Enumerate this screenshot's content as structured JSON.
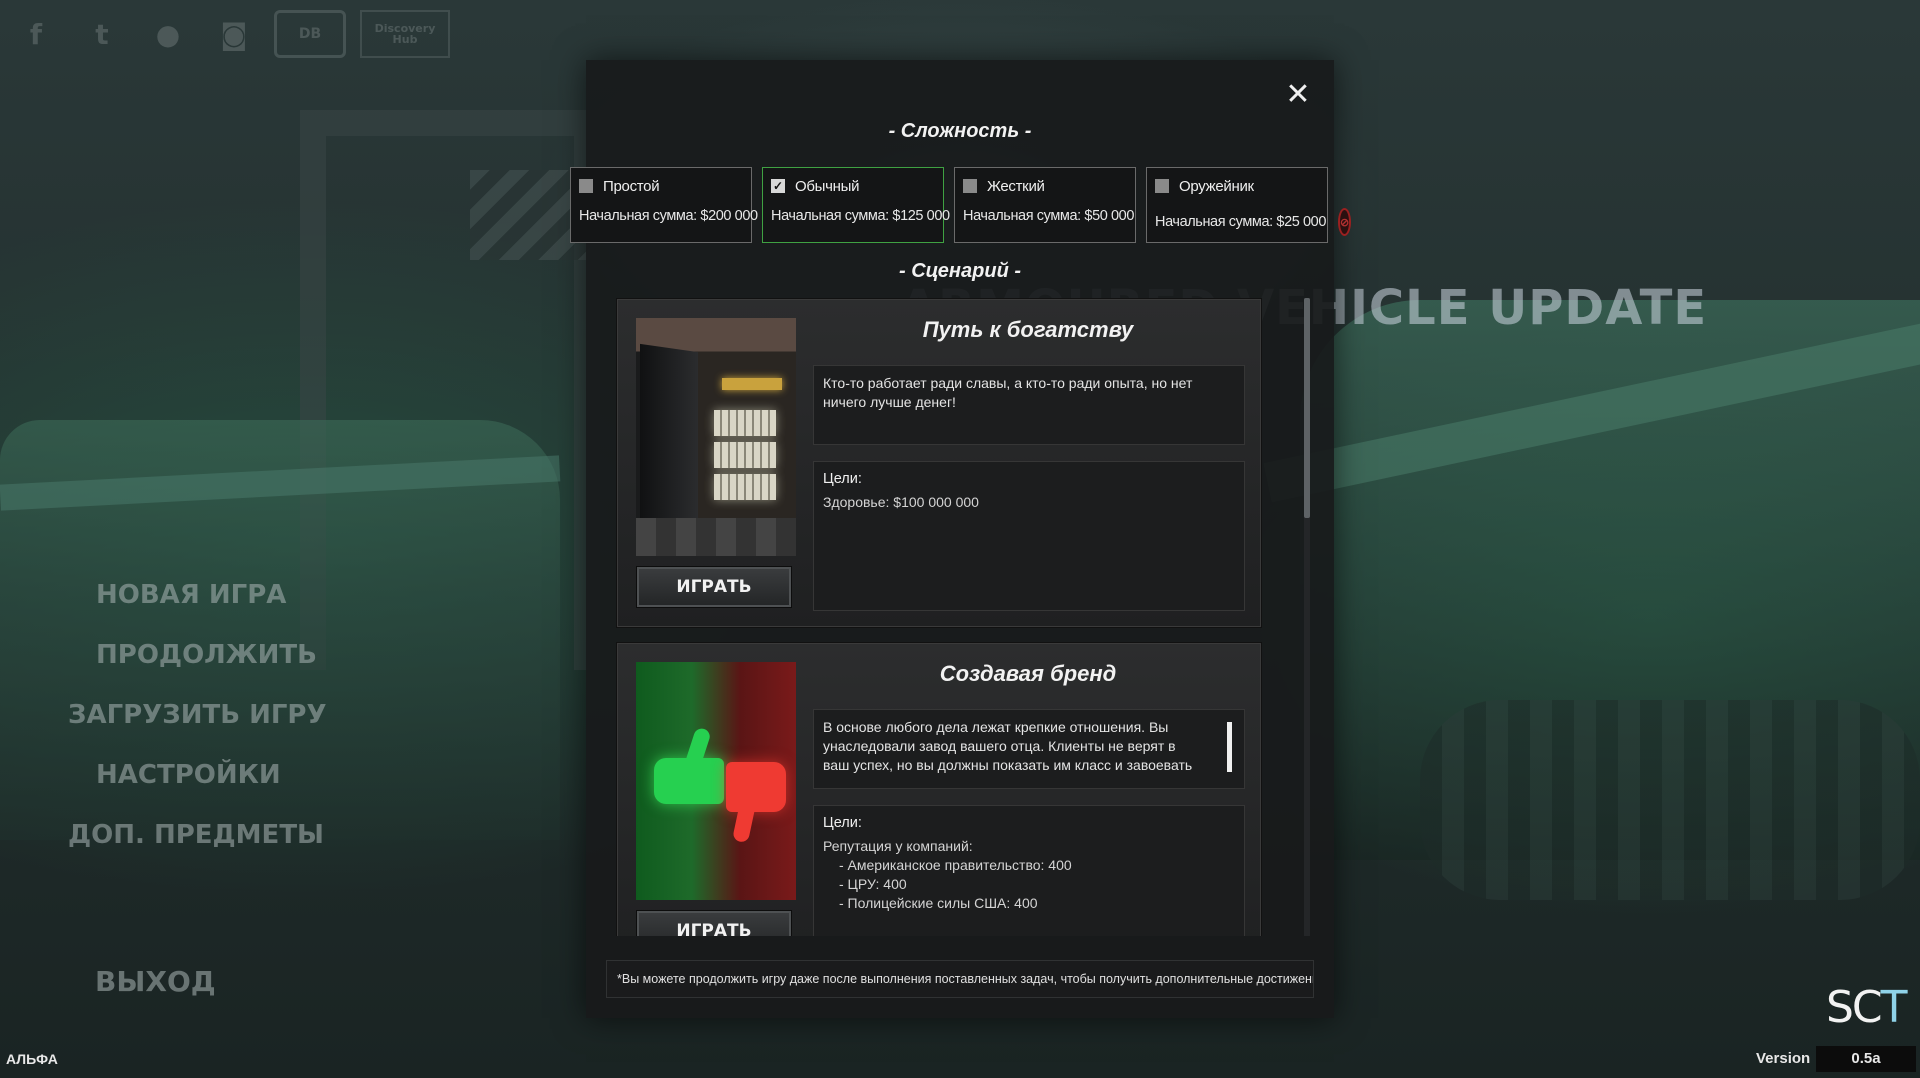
{
  "social": {
    "icons": [
      {
        "name": "facebook-icon",
        "glyph": "f"
      },
      {
        "name": "twitter-icon",
        "glyph": "t"
      },
      {
        "name": "reddit-icon",
        "glyph": "●"
      },
      {
        "name": "discord-icon",
        "glyph": "◙"
      },
      {
        "name": "indiedb-icon",
        "glyph": "DB"
      },
      {
        "name": "discovery-hub-icon",
        "glyph": "Discovery Hub"
      }
    ]
  },
  "background": {
    "update_title": "ARMOURED VEHICLE UPDATE"
  },
  "main_menu": {
    "items": [
      "НОВАЯ ИГРА",
      "ПРОДОЛЖИТЬ",
      "ЗАГРУЗИТЬ ИГРУ",
      "НАСТРОЙКИ",
      "ДОП. ПРЕДМЕТЫ"
    ],
    "exit": "ВЫХОД"
  },
  "footer": {
    "alpha": "АЛЬФА",
    "version_label": "Version",
    "version_value": "0.5a",
    "logo_text_a": "SC",
    "logo_text_b": "T"
  },
  "modal": {
    "close_glyph": "✕",
    "difficulty_title": "- Сложность -",
    "scenario_title": "- Сценарий -",
    "difficulties": [
      {
        "name": "Простой",
        "amount": "Начальная сумма: $200 000",
        "checked": false
      },
      {
        "name": "Обычный",
        "amount": "Начальная сумма: $125 000",
        "checked": true
      },
      {
        "name": "Жесткий",
        "amount": "Начальная сумма: $50 000",
        "checked": false
      },
      {
        "name": "Оружейник",
        "amount": "Начальная сумма: $25 000",
        "checked": false,
        "no_achievements_icon": true
      }
    ],
    "scenarios": [
      {
        "title": "Путь к богатству",
        "description": "Кто-то работает ради славы, а кто-то ради опыта, но нет ничего лучше денег!",
        "goals_label": "Цели:",
        "goals": [
          "Здоровье:  $100 000 000"
        ],
        "goal_subitems": [],
        "play_label": "ИГРАТЬ"
      },
      {
        "title": "Создавая бренд",
        "description": "В основе любого дела лежат крепкие отношения. Вы унаследовали завод вашего отца. Клиенты не верят в ваш успех, но вы должны показать им класс и завоевать",
        "goals_label": "Цели:",
        "goals": [
          "Репутация у компаний:"
        ],
        "goal_subitems": [
          "- Американское правительство: 400",
          "- ЦРУ: 400",
          "- Полицейские силы США: 400"
        ],
        "play_label": "ИГРАТЬ"
      }
    ],
    "footnote": "*Вы можете продолжить игру даже после выполнения поставленных задач, чтобы получить дополнительные достижения."
  },
  "colors": {
    "selected_border": "#3fa142",
    "card_border": "#6a6a6a",
    "modal_bg": "#181a1b"
  }
}
